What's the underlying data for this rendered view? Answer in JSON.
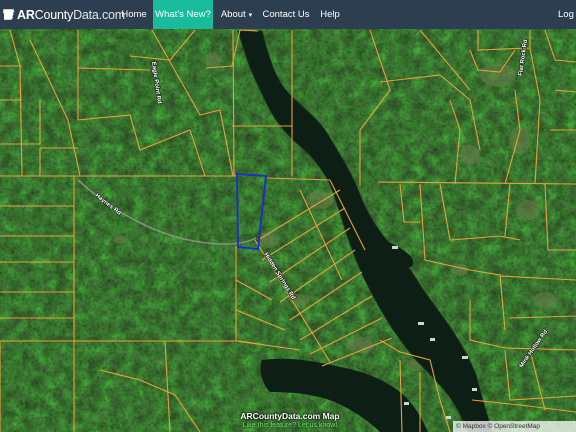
{
  "header": {
    "brand": {
      "strong": "AR",
      "rest": "County",
      "domain": "Data.com"
    },
    "nav": [
      {
        "label": "Home"
      },
      {
        "label": "What's New?",
        "active": true
      },
      {
        "label": "About",
        "caret": true
      },
      {
        "label": "Contact Us"
      },
      {
        "label": "Help"
      },
      {
        "label": "Log"
      }
    ],
    "active_color": "#18bc9c",
    "bar_color": "#2c3e50"
  },
  "map": {
    "road_labels": [
      "Haynes Rd",
      "Eagle Point Rd",
      "Hidden Springs Rd",
      "Flat Rock Rd",
      "Mink Hollow Rd"
    ],
    "parcel_line_color": "#e8a13a",
    "selected_parcel_color": "#1a2bd6",
    "water_color": "#0d1f14"
  },
  "footer": {
    "title": "ARCountyData.com Map",
    "feedback": "Like this feature? Let us know!",
    "attribution": {
      "mapbox": "© Mapbox",
      "osm": "© OpenStreetMap"
    }
  }
}
